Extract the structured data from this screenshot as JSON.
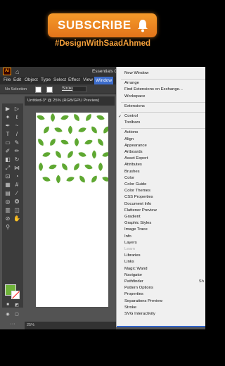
{
  "banner": {
    "subscribe_label": "SUBSCRIBE",
    "hashtag": "#DesignWithSaadAhmed",
    "bell_icon": "bell-icon"
  },
  "app": {
    "logo": "Ai",
    "workspace_label": "Essentials C",
    "menus": [
      "File",
      "Edit",
      "Object",
      "Type",
      "Select",
      "Effect",
      "View",
      "Window"
    ],
    "control_bar": {
      "selection_label": "No Selection",
      "stroke_label": "Stroke:"
    },
    "document_tab": "Untitled-3* @ 25% (RGB/GPU Preview)",
    "zoom": "25%",
    "colors": {
      "fill": "#6fb33a",
      "accent": "#3d6dcc",
      "leaf": "#5fa832"
    }
  },
  "window_menu": {
    "items": [
      {
        "label": "New Window"
      },
      {
        "separator": true
      },
      {
        "label": "Arrange"
      },
      {
        "label": "Find Extensions on Exchange..."
      },
      {
        "label": "Workspace"
      },
      {
        "separator": true
      },
      {
        "label": "Extensions"
      },
      {
        "separator": true
      },
      {
        "label": "Control",
        "checked": true
      },
      {
        "label": "Toolbars"
      },
      {
        "separator": true
      },
      {
        "label": "Actions"
      },
      {
        "label": "Align"
      },
      {
        "label": "Appearance"
      },
      {
        "label": "Artboards"
      },
      {
        "label": "Asset Export"
      },
      {
        "label": "Attributes"
      },
      {
        "label": "Brushes"
      },
      {
        "label": "Color"
      },
      {
        "label": "Color Guide"
      },
      {
        "label": "Color Themes"
      },
      {
        "label": "CSS Properties"
      },
      {
        "label": "Document Info"
      },
      {
        "label": "Flattener Preview"
      },
      {
        "label": "Gradient"
      },
      {
        "label": "Graphic Styles"
      },
      {
        "label": "Image Trace"
      },
      {
        "label": "Info"
      },
      {
        "label": "Layers"
      },
      {
        "label": "Learn",
        "disabled": true
      },
      {
        "label": "Libraries"
      },
      {
        "label": "Links"
      },
      {
        "label": "Magic Wand"
      },
      {
        "label": "Navigator"
      },
      {
        "label": "Pathfinder",
        "shortcut": "Sh"
      },
      {
        "label": "Pattern Options"
      },
      {
        "label": "Properties"
      },
      {
        "label": "Separations Preview"
      },
      {
        "label": "Stroke"
      },
      {
        "label": "SVG Interactivity"
      }
    ]
  }
}
